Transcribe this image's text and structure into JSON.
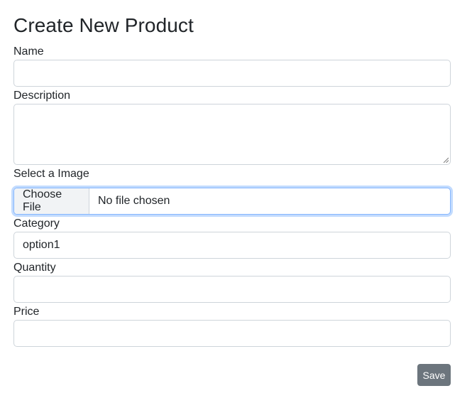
{
  "form": {
    "title": "Create New Product",
    "name": {
      "label": "Name",
      "value": ""
    },
    "description": {
      "label": "Description",
      "value": ""
    },
    "image": {
      "label": "Select a Image",
      "button_label": "Choose File",
      "status": "No file chosen"
    },
    "category": {
      "label": "Category",
      "selected": "option1"
    },
    "quantity": {
      "label": "Quantity",
      "value": ""
    },
    "price": {
      "label": "Price",
      "value": ""
    },
    "save_label": "Save"
  },
  "colors": {
    "save_button": "#6c757d",
    "focus_border": "#86b7fe",
    "field_border": "#ced4da"
  }
}
